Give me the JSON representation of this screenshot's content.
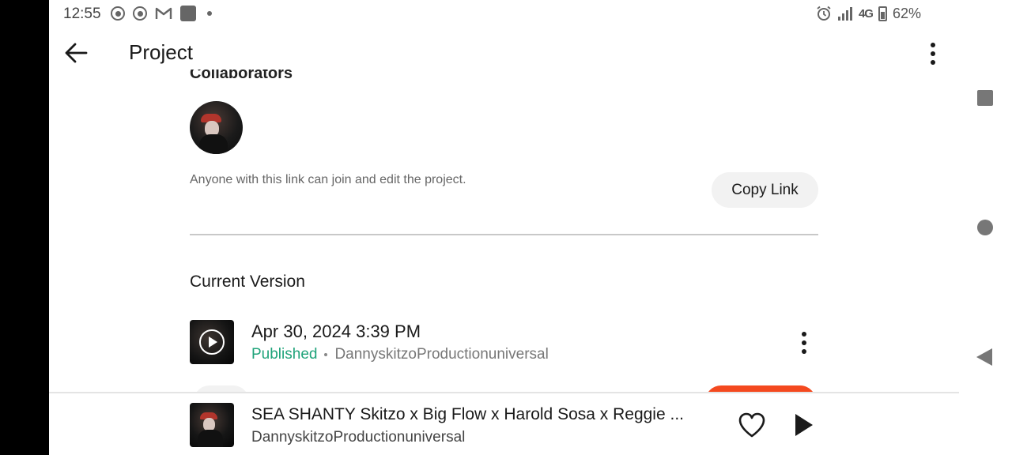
{
  "status_bar": {
    "time": "12:55",
    "network": "4G",
    "battery": "62%",
    "icons": [
      "record-icon",
      "record-icon",
      "gmail-icon",
      "app-icon",
      "notification-dot-icon",
      "alarm-icon",
      "signal-icon",
      "battery-icon"
    ]
  },
  "header": {
    "title": "Project",
    "back_icon": "arrow-left-icon",
    "more_icon": "more-vertical-icon"
  },
  "collaborators": {
    "heading": "Collaborators",
    "link_note": "Anyone with this link can join and edit the project.",
    "copy_link_label": "Copy Link"
  },
  "current_version": {
    "title": "Current Version",
    "date": "Apr 30, 2024 3:39 PM",
    "status": "Published",
    "separator": "·",
    "author": "DannyskitzoProductionuniversal"
  },
  "player": {
    "title": "SEA SHANTY Skitzo x Big Flow x Harold Sosa x Reggie ...",
    "artist": "DannyskitzoProductionuniversal",
    "heart_icon": "heart-outline-icon",
    "play_icon": "play-icon"
  },
  "nav": {
    "icons": [
      "recent-apps-icon",
      "home-icon",
      "back-icon"
    ]
  },
  "colors": {
    "accent_green": "#1fa37a",
    "accent_orange": "#f4491f",
    "text_primary": "#1a1a1a",
    "text_secondary": "#666666"
  }
}
